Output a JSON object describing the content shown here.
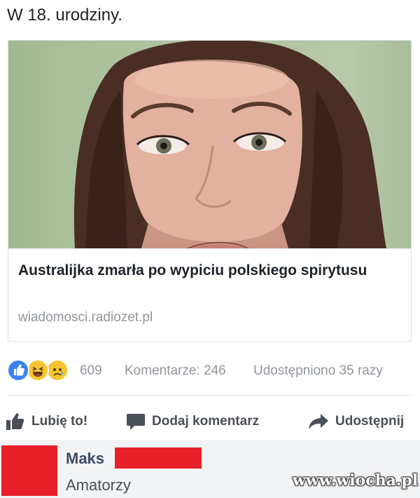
{
  "post": {
    "text": "W 18. urodziny."
  },
  "link_card": {
    "image": "portrait-photo",
    "title": "Australijka zmarła po wypiciu polskiego spirytusu",
    "domain": "wiadomosci.radiozet.pl"
  },
  "stats": {
    "reaction_icons": [
      "like-icon",
      "haha-icon",
      "sad-icon"
    ],
    "reaction_count": "609",
    "comments": "Komentarze: 246",
    "shares": "Udostępniono 35 razy"
  },
  "actions": {
    "like_label": "Lubię to!",
    "comment_label": "Dodaj komentarz",
    "share_label": "Udostępnij"
  },
  "comment": {
    "author": "Maks",
    "text": "Amatorzy",
    "redaction_color": "#e8202a"
  },
  "watermark": {
    "text": "www.wiocha.pl"
  },
  "colors": {
    "facebook_blue": "#3b82f6",
    "meta_text": "#90949c",
    "action_text": "#4b4f56",
    "comment_bg": "#f2f3f5"
  }
}
